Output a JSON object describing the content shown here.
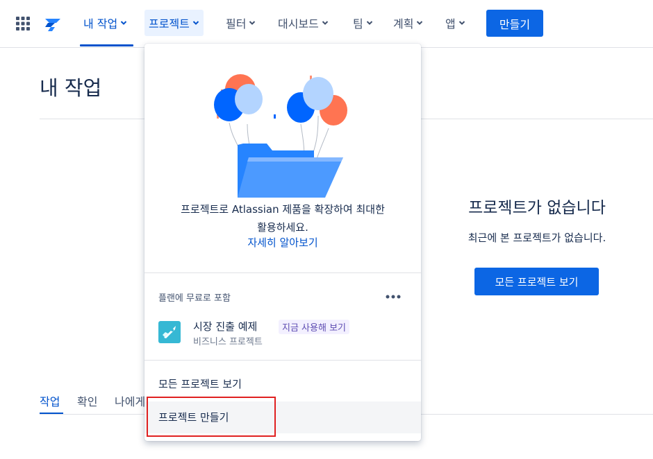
{
  "nav": {
    "items": [
      {
        "label": "내 작업"
      },
      {
        "label": "프로젝트"
      },
      {
        "label": "필터"
      },
      {
        "label": "대시보드"
      },
      {
        "label": "팀"
      },
      {
        "label": "계획"
      },
      {
        "label": "앱"
      }
    ],
    "create_label": "만들기",
    "accent": "#0052cc",
    "button_color": "#0c66e4"
  },
  "page": {
    "title": "내 작업",
    "tabs": [
      {
        "label": "작업"
      },
      {
        "label": "확인"
      },
      {
        "label": "나에게"
      }
    ]
  },
  "empty_state": {
    "title": "프로젝트가 없습니다",
    "subtitle": "최근에 본 프로젝트가 없습니다.",
    "button_label": "모든 프로젝트 보기"
  },
  "projects_menu": {
    "promo_line1": "프로젝트로 Atlassian 제품을 확장하여 최대한",
    "promo_line2": "활용하세요.",
    "promo_link": "자세히 알아보기",
    "section_heading": "플랜에 무료로 포함",
    "template": {
      "name": "시장 진출 예제",
      "badge": "지금 사용해 보기",
      "type": "비즈니스 프로젝트"
    },
    "view_all": "모든 프로젝트 보기",
    "create_project": "프로젝트 만들기"
  },
  "icons": [
    "app-switcher-icon",
    "jira-logo-icon",
    "chevron-down-icon",
    "more-icon",
    "rocket-icon",
    "balloons-folder-illustration"
  ]
}
